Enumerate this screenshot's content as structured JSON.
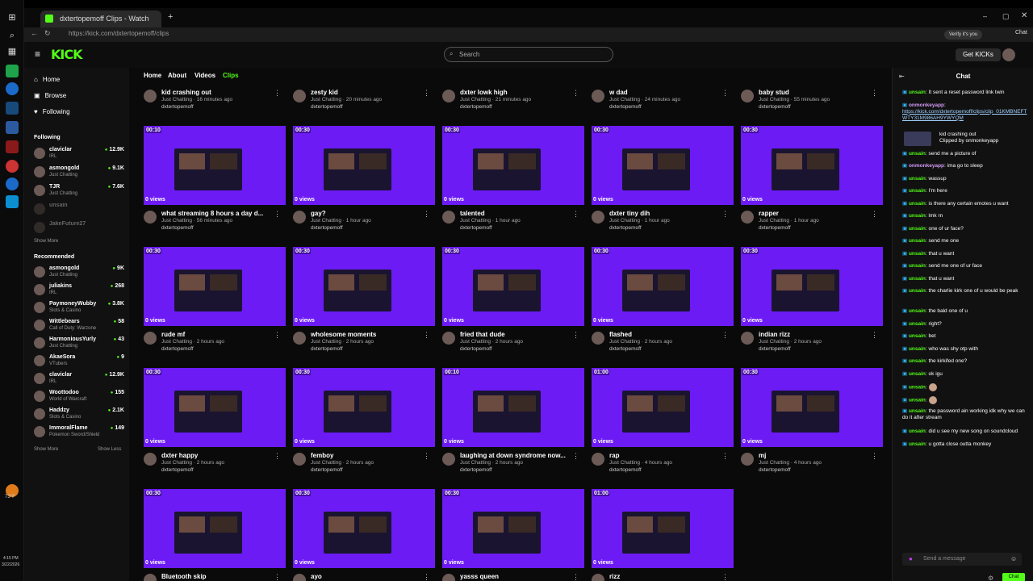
{
  "browser": {
    "tab_title": "dxtertopemoff Clips - Watch",
    "url": "https://kick.com/dxtertopemoff/clips",
    "profile_label": "Verify it's you",
    "chat_label": "Chat"
  },
  "taskbar": {
    "temp": "73°F",
    "time": "4:15 PM",
    "date": "3/22/2026"
  },
  "header": {
    "logo": "KICK",
    "search_placeholder": "Search",
    "get_kicks_label": "Get KICKs"
  },
  "nav": {
    "home": "Home",
    "browse": "Browse",
    "following": "Following",
    "following_title": "Following",
    "following_channels": [
      {
        "name": "claviclar",
        "category": "IRL",
        "viewers": "12.9K"
      },
      {
        "name": "asmongold",
        "category": "Just Chatting",
        "viewers": "9.1K"
      },
      {
        "name": "TJR",
        "category": "Just Chatting",
        "viewers": "7.6K"
      },
      {
        "name": "unsain",
        "category": "",
        "viewers": ""
      },
      {
        "name": "JakeFuture27",
        "category": "",
        "viewers": ""
      }
    ],
    "show_more": "Show More",
    "recommended_title": "Recommended",
    "recommended_channels": [
      {
        "name": "asmongold",
        "category": "Just Chatting",
        "viewers": "9K"
      },
      {
        "name": "juliakins",
        "category": "IRL",
        "viewers": "268"
      },
      {
        "name": "PaymoneyWubby",
        "category": "Slots & Casino",
        "viewers": "3.8K"
      },
      {
        "name": "Wittlebears",
        "category": "Call of Duty: Warzone",
        "viewers": "58"
      },
      {
        "name": "HarmoniousYurly",
        "category": "Just Chatting",
        "viewers": "43"
      },
      {
        "name": "AkaeSora",
        "category": "VTubers",
        "viewers": "9"
      },
      {
        "name": "claviclar",
        "category": "IRL",
        "viewers": "12.9K"
      },
      {
        "name": "Woottodoo",
        "category": "World of Warcraft",
        "viewers": "155"
      },
      {
        "name": "Haddzy",
        "category": "Slots & Casino",
        "viewers": "2.1K"
      },
      {
        "name": "ImmoralFlame",
        "category": "Pokemon Sword/Shield",
        "viewers": "149"
      }
    ],
    "show_more_2": "Show More",
    "show_less": "Show Less"
  },
  "main": {
    "tabs": [
      "Home",
      "About",
      "Videos",
      "Clips"
    ],
    "clips": [
      {
        "title": "kid crashing out",
        "category": "Just Chatting",
        "age": "16 minutes ago",
        "channel": "dxtertopemoff",
        "duration": "",
        "views": ""
      },
      {
        "title": "zesty kid",
        "category": "Just Chatting",
        "age": "20 minutes ago",
        "channel": "dxtertopemoff",
        "duration": "",
        "views": ""
      },
      {
        "title": "dxter lowk high",
        "category": "Just Chatting",
        "age": "21 minutes ago",
        "channel": "dxtertopemoff",
        "duration": "",
        "views": ""
      },
      {
        "title": "w dad",
        "category": "Just Chatting",
        "age": "24 minutes ago",
        "channel": "dxtertopemoff",
        "duration": "",
        "views": ""
      },
      {
        "title": "baby stud",
        "category": "Just Chatting",
        "age": "55 minutes ago",
        "channel": "dxtertopemoff",
        "duration": "",
        "views": ""
      },
      {
        "title": "what streaming 8 hours a day d...",
        "category": "Just Chatting",
        "age": "56 minutes ago",
        "channel": "dxtertopemoff",
        "duration": "00:10",
        "views": "0 views"
      },
      {
        "title": "gay?",
        "category": "Just Chatting",
        "age": "1 hour ago",
        "channel": "dxtertopemoff",
        "duration": "00:30",
        "views": "0 views"
      },
      {
        "title": "talented",
        "category": "Just Chatting",
        "age": "1 hour ago",
        "channel": "dxtertopemoff",
        "duration": "00:30",
        "views": "0 views"
      },
      {
        "title": "dxter tiny dih",
        "category": "Just Chatting",
        "age": "1 hour ago",
        "channel": "dxtertopemoff",
        "duration": "00:30",
        "views": "0 views"
      },
      {
        "title": "rapper",
        "category": "Just Chatting",
        "age": "1 hour ago",
        "channel": "dxtertopemoff",
        "duration": "00:30",
        "views": "0 views"
      },
      {
        "title": "rude mf",
        "category": "Just Chatting",
        "age": "2 hours ago",
        "channel": "dxtertopemoff",
        "duration": "00:30",
        "views": "0 views"
      },
      {
        "title": "wholesome moments",
        "category": "Just Chatting",
        "age": "2 hours ago",
        "channel": "dxtertopemoff",
        "duration": "00:30",
        "views": "0 views"
      },
      {
        "title": "fried that dude",
        "category": "Just Chatting",
        "age": "2 hours ago",
        "channel": "dxtertopemoff",
        "duration": "00:30",
        "views": "0 views"
      },
      {
        "title": "flashed",
        "category": "Just Chatting",
        "age": "2 hours ago",
        "channel": "dxtertopemoff",
        "duration": "00:30",
        "views": "0 views"
      },
      {
        "title": "indian rizz",
        "category": "Just Chatting",
        "age": "2 hours ago",
        "channel": "dxtertopemoff",
        "duration": "00:30",
        "views": "0 views"
      },
      {
        "title": "dxter happy",
        "category": "Just Chatting",
        "age": "2 hours ago",
        "channel": "dxtertopemoff",
        "duration": "00:30",
        "views": "0 views"
      },
      {
        "title": "femboy",
        "category": "Just Chatting",
        "age": "2 hours ago",
        "channel": "dxtertopemoff",
        "duration": "00:30",
        "views": "0 views"
      },
      {
        "title": "laughing at down syndrome now...",
        "category": "Just Chatting",
        "age": "2 hours ago",
        "channel": "dxtertopemoff",
        "duration": "00:10",
        "views": "0 views"
      },
      {
        "title": "rap",
        "category": "Just Chatting",
        "age": "4 hours ago",
        "channel": "dxtertopemoff",
        "duration": "01:00",
        "views": "0 views"
      },
      {
        "title": "mj",
        "category": "Just Chatting",
        "age": "4 hours ago",
        "channel": "dxtertopemoff",
        "duration": "00:30",
        "views": "0 views"
      },
      {
        "title": "Bluetooth skip",
        "category": "",
        "age": "",
        "channel": "",
        "duration": "00:30",
        "views": "0 views"
      },
      {
        "title": "ayo",
        "category": "",
        "age": "",
        "channel": "",
        "duration": "00:30",
        "views": "0 views"
      },
      {
        "title": "yasss queen",
        "category": "",
        "age": "",
        "channel": "",
        "duration": "00:30",
        "views": "0 views"
      },
      {
        "title": "rizz",
        "category": "",
        "age": "",
        "channel": "",
        "duration": "01:00",
        "views": "0 views"
      }
    ]
  },
  "chat": {
    "title": "Chat",
    "messages": [
      {
        "user": "unsain",
        "text": "It sent a reset password link twin"
      },
      {
        "user": "onmonkeyapp",
        "text": "",
        "link": "https://kick.com/dxtertopemoff/clips/clip_01KMBNEFTWTY31M986AH9YWYQM"
      },
      {
        "user": "",
        "text": "kid crashing out",
        "sub": "Clipped by onmonkeyapp"
      },
      {
        "user": "unsain",
        "text": "send me a picture of"
      },
      {
        "user": "onmonkeyapp",
        "text": "ima go to sleep"
      },
      {
        "user": "unsain",
        "text": "wassup"
      },
      {
        "user": "unsain",
        "text": "I'm here"
      },
      {
        "user": "unsain",
        "text": "is there any certain emotes u want"
      },
      {
        "user": "unsain",
        "text": "lmk rn"
      },
      {
        "user": "unsain",
        "text": "one of ur face?"
      },
      {
        "user": "unsain",
        "text": "send me one"
      },
      {
        "user": "unsain",
        "text": "that u want"
      },
      {
        "user": "unsain",
        "text": "send me one of ur face"
      },
      {
        "user": "unsain",
        "text": "that u want"
      },
      {
        "user": "unsain",
        "text": "the charlie kirk one of u would be peak"
      },
      {
        "user": "unsain",
        "text": "the bald one of u"
      },
      {
        "user": "unsain",
        "text": "right?"
      },
      {
        "user": "unsain",
        "text": "bet"
      },
      {
        "user": "unsain",
        "text": "who was shy otp with"
      },
      {
        "user": "unsain",
        "text": "the kirkifed one?"
      },
      {
        "user": "unsain",
        "text": "ok igu"
      },
      {
        "user": "unsain",
        "text": ""
      },
      {
        "user": "unsain",
        "text": ""
      },
      {
        "user": "unsain",
        "text": "the password ain working idk why we can do it after stream"
      },
      {
        "user": "unsain",
        "text": "did u see my new song on soundcloud"
      },
      {
        "user": "unsain",
        "text": "u gotta close outta monkey"
      }
    ],
    "input_placeholder": "Send a message",
    "send_label": "Chat"
  },
  "colors": {
    "accent": "#53fc18",
    "thumb": "#6c1bf5",
    "bg": "#0a0a0a"
  }
}
